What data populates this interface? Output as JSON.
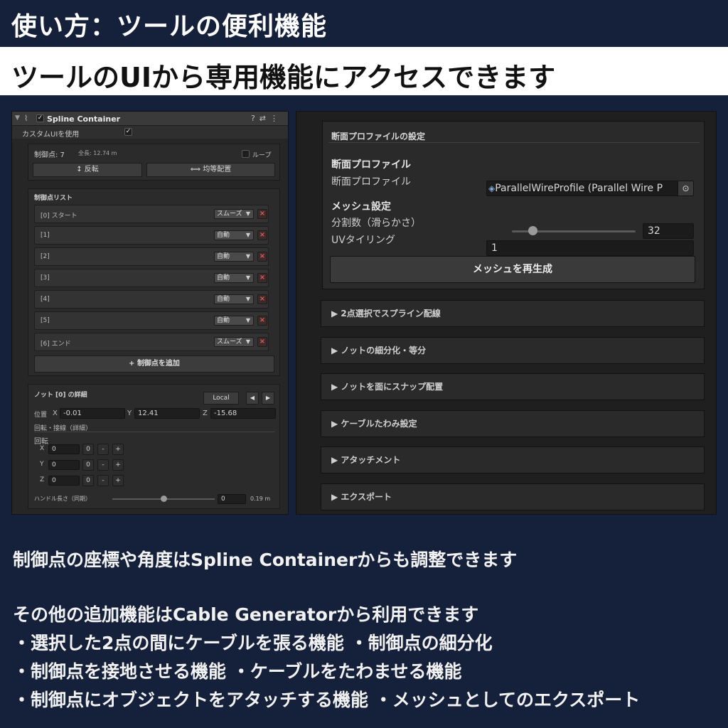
{
  "page": {
    "title": "使い方：ツールの便利機能",
    "subtitle": "ツールのUIから専用機能にアクセスできます"
  },
  "inspector": {
    "component_name": "Spline Container",
    "custom_ui_label": "カスタムUIを使用",
    "control_points_label": "制御点: 7",
    "total_length_label": "全長: 12.74 m",
    "loop_label": "ループ",
    "reverse_button": "反転",
    "equal_spacing_button": "均等配置",
    "list_title": "制御点リスト",
    "rows": [
      {
        "label": "[0] スタート",
        "mode": "スムーズ"
      },
      {
        "label": "[1]",
        "mode": "自動"
      },
      {
        "label": "[2]",
        "mode": "自動"
      },
      {
        "label": "[3]",
        "mode": "自動"
      },
      {
        "label": "[4]",
        "mode": "自動"
      },
      {
        "label": "[5]",
        "mode": "自動"
      },
      {
        "label": "[6] エンド",
        "mode": "スムーズ"
      }
    ],
    "add_point_button": "制御点を追加",
    "knot": {
      "title": "ノット [0] の詳細",
      "space_button": "Local",
      "position_label": "位置",
      "x_label": "X",
      "x_value": "-0.01",
      "y_label": "Y",
      "y_value": "12.41",
      "z_label": "Z",
      "z_value": "-15.68",
      "rot_tan_label": "回転・接線（詳細）",
      "rotation_label": "回転",
      "rot": [
        {
          "axis": "X",
          "value": "0",
          "zero": "0",
          "minus": "-",
          "plus": "+"
        },
        {
          "axis": "Y",
          "value": "0",
          "zero": "0",
          "minus": "-",
          "plus": "+"
        },
        {
          "axis": "Z",
          "value": "0",
          "zero": "0",
          "minus": "-",
          "plus": "+"
        }
      ],
      "handle_label": "ハンドル長さ（同期）",
      "handle_value": "0",
      "handle_length": "0.19 m",
      "handle_slider_fraction": 0.5
    }
  },
  "generator": {
    "profile_header": "断面プロファイルの設定",
    "profile_section": "断面プロファイル",
    "profile_label": "断面プロファイル",
    "profile_value": "ParallelWireProfile (Parallel Wire P",
    "mesh_section": "メッシュ設定",
    "segments_label": "分割数（滑らかさ）",
    "segments_value": "32",
    "segments_slider_fraction": 0.13,
    "uv_label": "UVタイリング",
    "uv_value": "1",
    "regen_button": "メッシュを再生成",
    "foldouts": [
      "▶  2点選択でスプライン配線",
      "▶  ノットの細分化・等分",
      "▶  ノットを面にスナップ配置",
      "▶  ケーブルたわみ設定",
      "▶  アタッチメント",
      "▶  エクスポート"
    ]
  },
  "body": {
    "line1": "制御点の座標や角度はSpline Containerからも調整できます",
    "line2": "その他の追加機能はCable Generatorから利用できます",
    "line3": "・選択した2点の間にケーブルを張る機能 ・制御点の細分化",
    "line4": "・制御点を接地させる機能 ・ケーブルをたわませる機能",
    "line5": "・制御点にオブジェクトをアタッチする機能 ・メッシュとしてのエクスポート"
  },
  "colors": {
    "background": "#15213a",
    "panel": "#262626",
    "delete_x": "#e05a5a"
  }
}
